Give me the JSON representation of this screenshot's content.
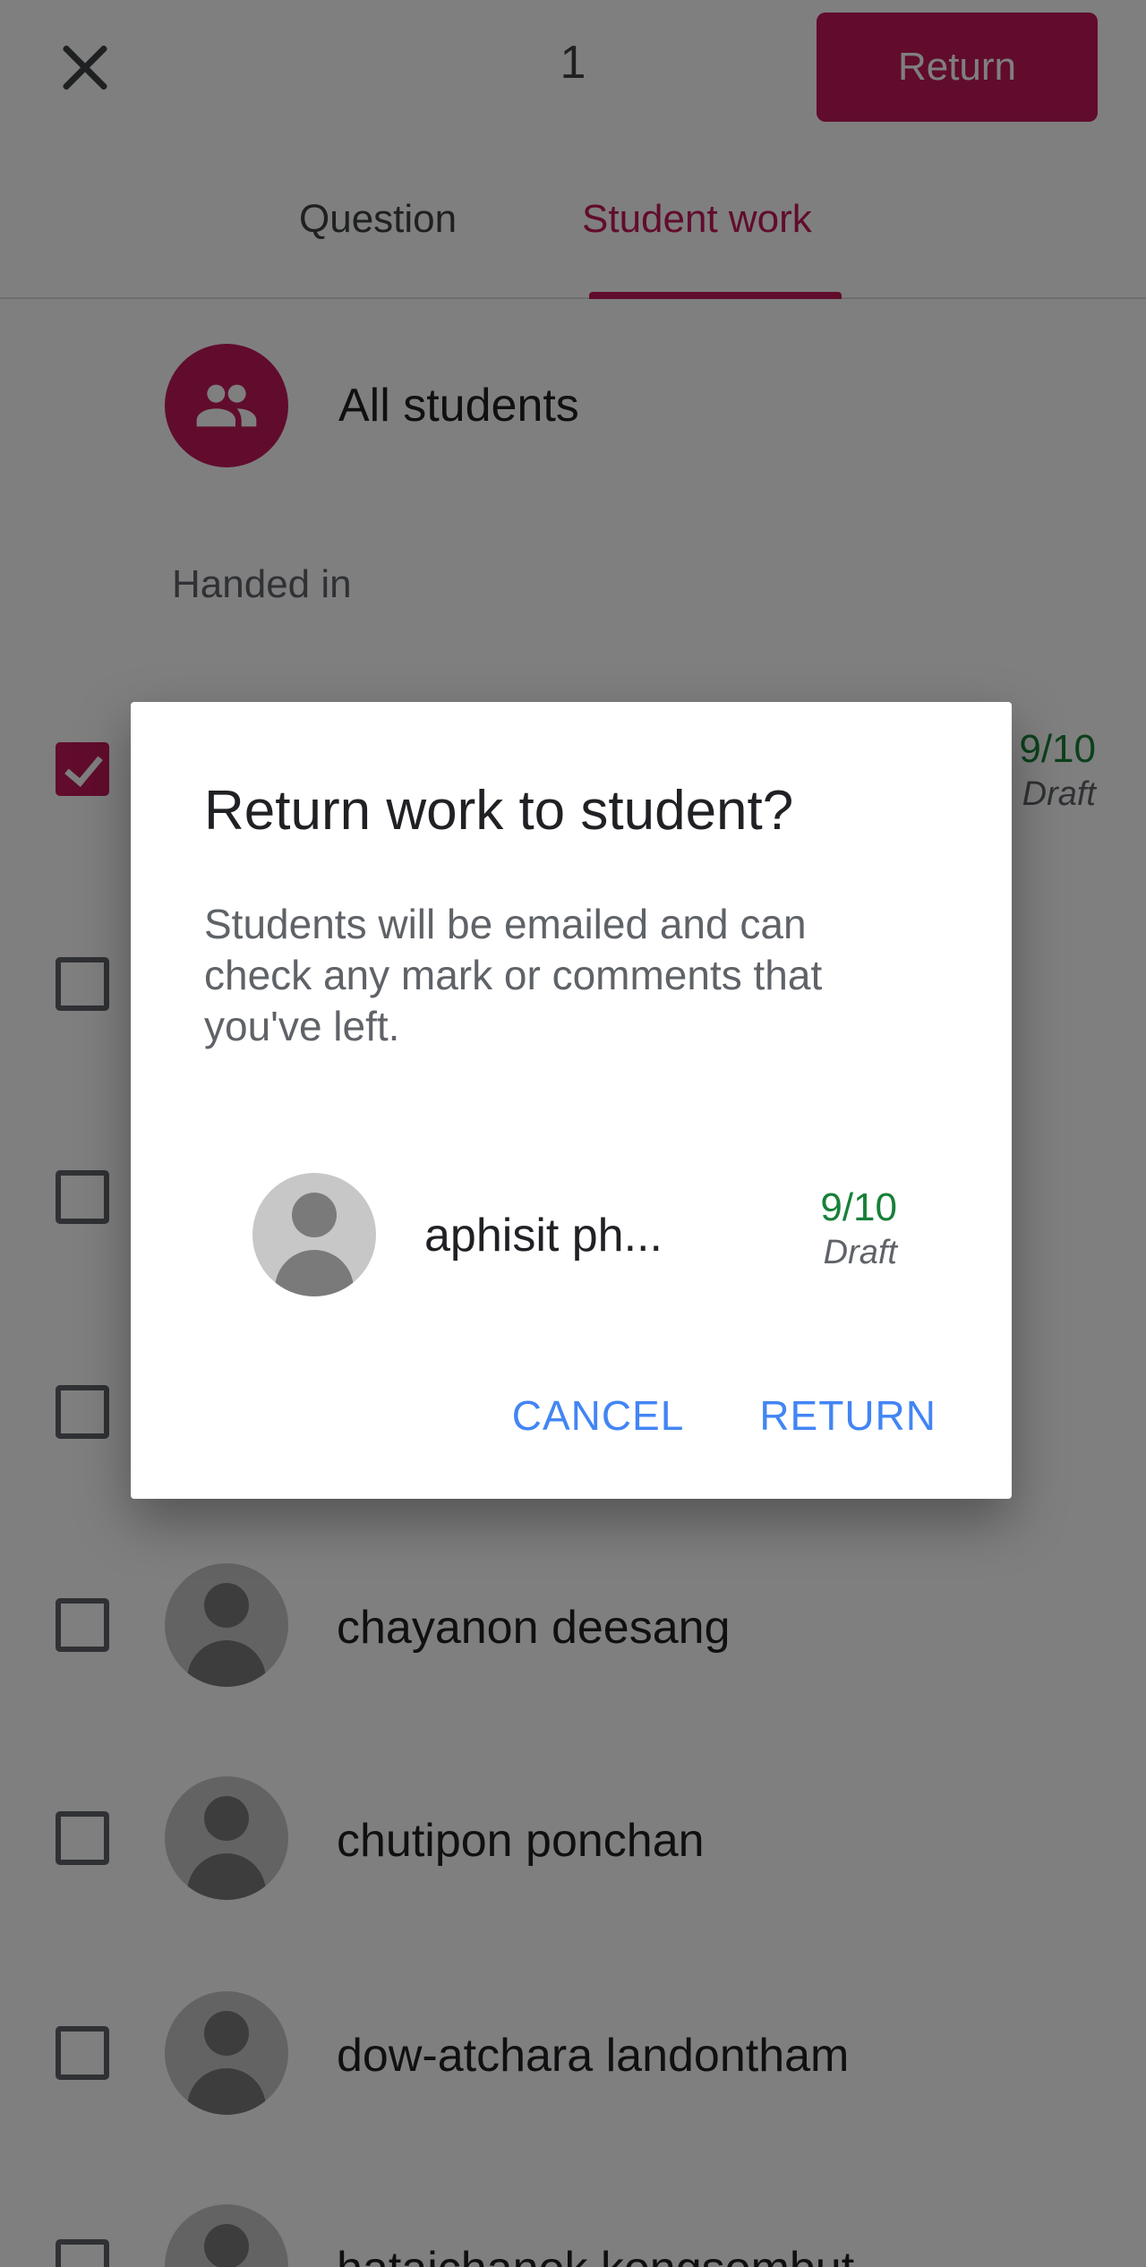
{
  "header": {
    "selected_count": "1",
    "return_label": "Return"
  },
  "tabs": [
    {
      "label": "Question"
    },
    {
      "label": "Student work"
    }
  ],
  "filter": {
    "all_students_label": "All students"
  },
  "section": {
    "handed_in_label": "Handed in"
  },
  "students": [
    {
      "name": "aphisit ph...",
      "score": "9/10",
      "status": "Draft",
      "checked": true
    },
    {
      "name": "",
      "checked": false
    },
    {
      "name": "",
      "checked": false
    },
    {
      "name": "",
      "checked": false
    },
    {
      "name": "chayanon deesang",
      "checked": false
    },
    {
      "name": "chutipon ponchan",
      "checked": false
    },
    {
      "name": "dow-atchara landontham",
      "checked": false
    },
    {
      "name": "hataichanok kongsombut",
      "checked": false
    }
  ],
  "dialog": {
    "title": "Return work to student?",
    "body": "Students will be emailed and can check any mark or comments that you've left.",
    "student_name": "aphisit ph...",
    "score": "9/10",
    "status": "Draft",
    "cancel_label": "CANCEL",
    "return_label": "RETURN"
  },
  "colors": {
    "accent": "#c2185b",
    "grade": "#188038",
    "dialog_button": "#4285f4"
  },
  "icons": [
    "close-icon",
    "group-icon",
    "checkbox-checked-icon",
    "checkbox-empty-icon",
    "person-icon"
  ]
}
